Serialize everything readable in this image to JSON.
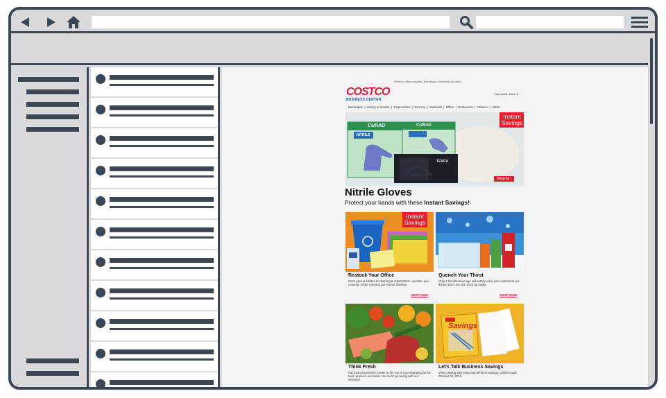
{
  "browser": {
    "back_icon": "back-arrow-icon",
    "forward_icon": "forward-arrow-icon",
    "home_icon": "home-icon",
    "search_icon": "search-icon",
    "menu_icon": "hamburger-menu-icon",
    "frame_color": "#3d4753",
    "chrome_color": "#d9dadb"
  },
  "email": {
    "preheader": "Restock office supplies, beverages, meat and produce.",
    "logo": {
      "main": "COSTCO",
      "sub": "BUSINESS CENTER"
    },
    "view_online": "View email online ►",
    "categories": [
      "Beverages",
      "Candy & Snacks",
      "Disposables",
      "Grocery",
      "Janitorial",
      "Office",
      "Restaurant",
      "Tobacco",
      "NEW"
    ],
    "badge_line1": "Instant",
    "badge_line2": "Savings",
    "hero": {
      "product_brand": "CURAD",
      "product_type": "NITRILE",
      "product_brand_2": "TENDA",
      "title": "Nitrile Gloves",
      "subtitle_prefix": "Protect your hands with these ",
      "subtitle_bold": "Instant Savings!",
      "shop_all": "Shop All ›"
    },
    "promos": [
      {
        "title": "Restock Your Office",
        "text": "From pens & folders to cleaning & organization, we have you covered. Order now and get Instant Savings.",
        "cta": "SHOP NOW"
      },
      {
        "title": "Quench Your Thirst",
        "text": "Only a favorite beverage will satisfy when your customers are thirsty. Don't run out, stock up today!",
        "cta": "SHOP NOW"
      },
      {
        "title": "Think Fresh",
        "text": "Put Costco Business Center at the top of your shopping list for fresh produce and meat. You won't go wrong with our selection."
      },
      {
        "title": "Let's Talk Business Savings",
        "text": "View Catalog with more than $750 of savings, valid through October 13, 2015."
      }
    ],
    "catalog_cover_label": "Savings"
  }
}
